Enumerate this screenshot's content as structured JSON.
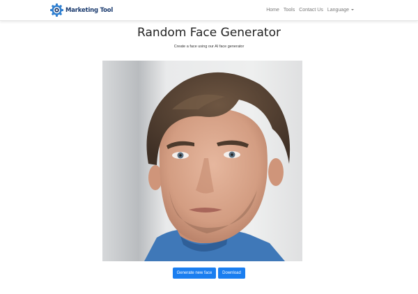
{
  "navbar": {
    "brand_name": "Marketing Tool",
    "brand_icon": "gear-icon",
    "links": [
      {
        "label": "Home"
      },
      {
        "label": "Tools"
      },
      {
        "label": "Contact Us"
      },
      {
        "label": "Language"
      }
    ]
  },
  "main": {
    "title": "Random Face Generator",
    "subtitle": "Create a face using our AI face generator",
    "buttons": {
      "generate_label": "Generate new face",
      "download_label": "Download"
    }
  },
  "colors": {
    "brand": "#1a3a6e",
    "accent": "#1a7ef0"
  }
}
